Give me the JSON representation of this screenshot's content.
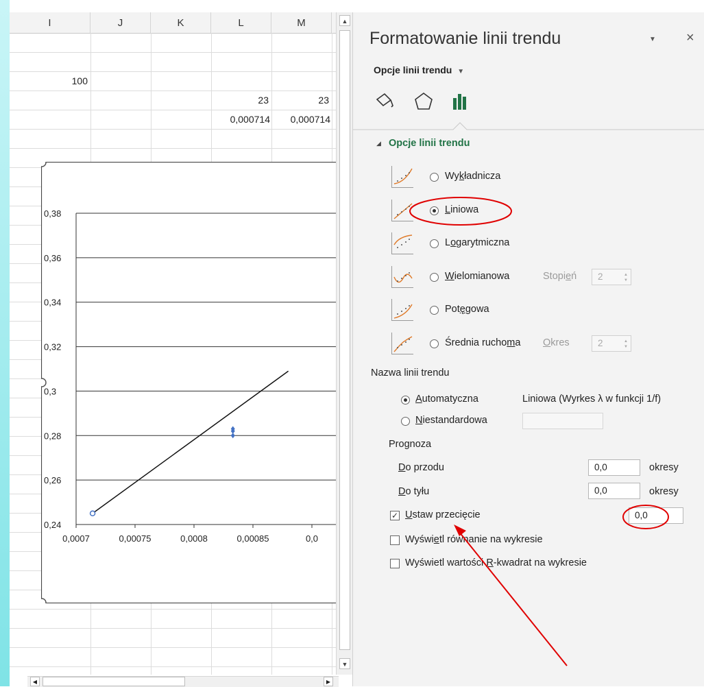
{
  "sheet": {
    "columns": [
      "I",
      "J",
      "K",
      "L",
      "M"
    ],
    "cells": {
      "i3": "100",
      "l4": "23",
      "m4": "23",
      "l5": "0,000714",
      "m5": "0,000714"
    }
  },
  "chart_data": {
    "type": "scatter",
    "title": "",
    "xlabel": "",
    "ylabel": "",
    "x_ticks": [
      "0,0007",
      "0,00075",
      "0,0008",
      "0,00085",
      "0,0"
    ],
    "y_ticks": [
      "0,38",
      "0,36",
      "0,34",
      "0,32",
      "0,3",
      "0,28",
      "0,26",
      "0,24"
    ],
    "xlim": [
      0.0007,
      0.00088
    ],
    "ylim": [
      0.24,
      0.38
    ],
    "grid": "horizontal",
    "series": [
      {
        "x": [
          0.000714,
          0.000833,
          0.000833,
          0.000833
        ],
        "y": [
          0.245,
          0.28,
          0.282,
          0.283
        ]
      }
    ],
    "trendline": {
      "type": "linear",
      "x": [
        0.000714,
        0.00088
      ],
      "y": [
        0.245,
        0.309
      ]
    }
  },
  "pane": {
    "title": "Formatowanie linii trendu",
    "dropdown": "Opcje linii trendu",
    "section": "Opcje linii trendu",
    "types": [
      {
        "pre": "Wy",
        "u": "k",
        "post": "ładnicza",
        "selected": false
      },
      {
        "pre": "",
        "u": "L",
        "post": "iniowa",
        "selected": true
      },
      {
        "pre": "L",
        "u": "o",
        "post": "garytmiczna",
        "selected": false
      },
      {
        "pre": "",
        "u": "W",
        "post": "ielomianowa",
        "selected": false
      },
      {
        "pre": "Pot",
        "u": "ę",
        "post": "gowa",
        "selected": false
      },
      {
        "pre": "Średnia rucho",
        "u": "m",
        "post": "a",
        "selected": false
      }
    ],
    "stopien": {
      "pre": "Stopi",
      "u": "e",
      "post": "ń",
      "value": "2"
    },
    "okres": {
      "pre": "",
      "u": "O",
      "post": "kres",
      "value": "2"
    },
    "name_label": "Nazwa linii trendu",
    "auto": {
      "pre": "",
      "u": "A",
      "post": "utomatyczna",
      "value": "Liniowa (Wyrkes λ w funkcji 1/f)"
    },
    "custom": {
      "pre": "",
      "u": "N",
      "post": "iestandardowa",
      "value": ""
    },
    "forecast": "Prognoza",
    "forward": {
      "pre": "",
      "u": "D",
      "post": "o przodu",
      "value": "0,0",
      "unit": "okresy"
    },
    "backward": {
      "pre": "",
      "u": "D",
      "post": "o tyłu",
      "value": "0,0",
      "unit": "okresy"
    },
    "intercept": {
      "pre": "",
      "u": "U",
      "post": "staw przecięcie",
      "value": "0,0"
    },
    "show_eq": {
      "pre": "Wyświ",
      "u": "e",
      "post": "tl równanie na wykresie"
    },
    "show_r2": {
      "pre": "Wyświetl wartości ",
      "u": "R",
      "post": "-kwadrat na wykresie"
    }
  },
  "colors": {
    "accent": "#217346",
    "annotation": "#e00000",
    "marker": "#4472c4"
  }
}
